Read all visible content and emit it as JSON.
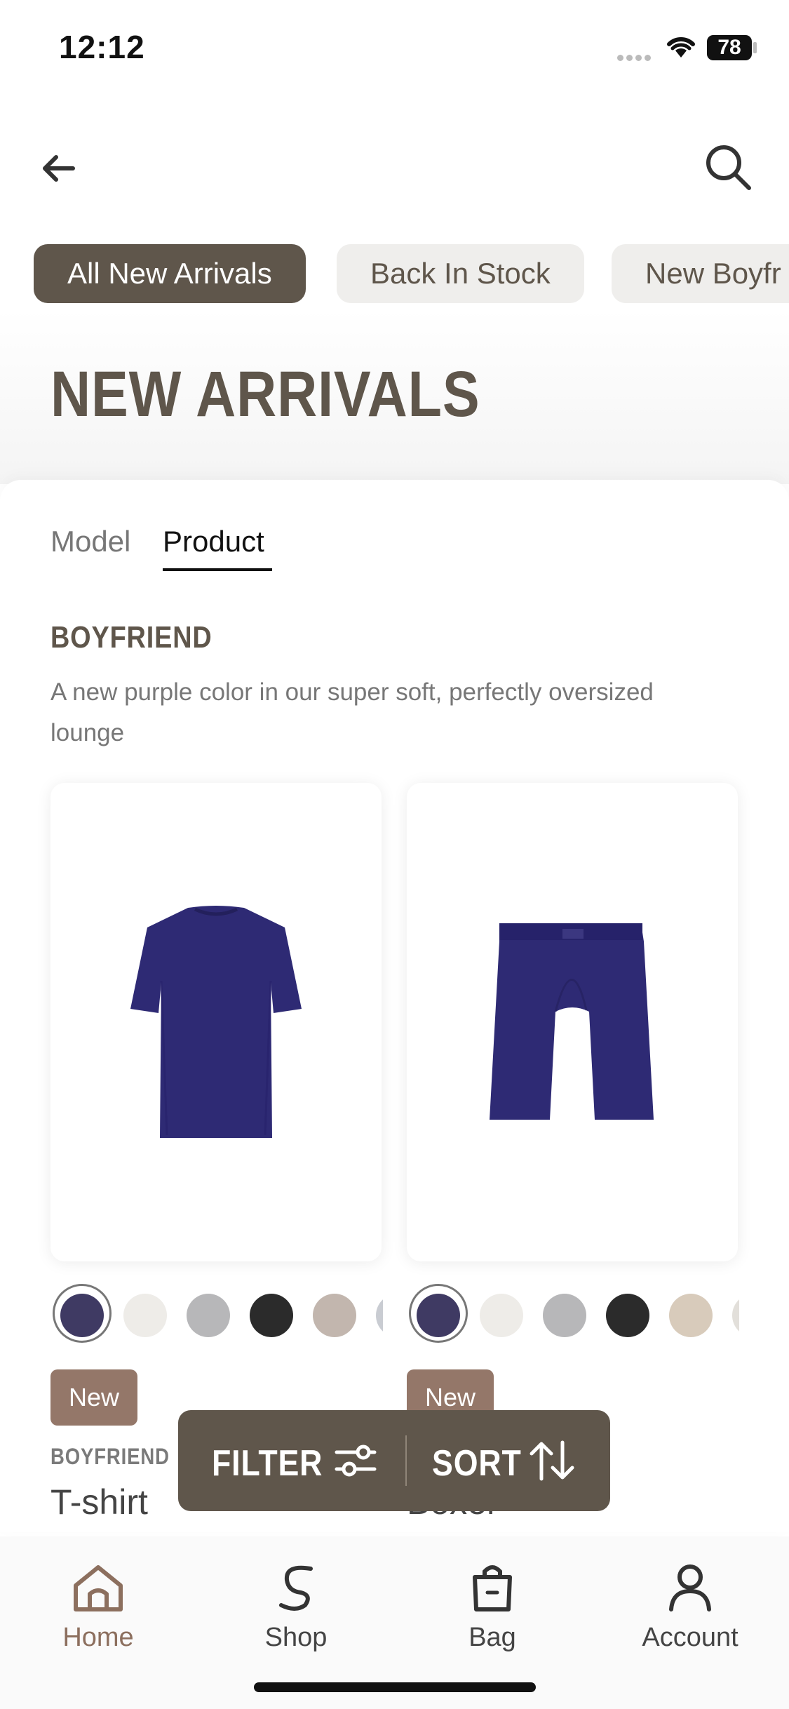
{
  "status_bar": {
    "time": "12:12",
    "battery": "78"
  },
  "chips": [
    {
      "label": "All New Arrivals"
    },
    {
      "label": "Back In Stock"
    },
    {
      "label": "New Boyfr"
    }
  ],
  "page_title": "NEW ARRIVALS",
  "view_tabs": {
    "model": "Model",
    "product": "Product",
    "selected": "Product"
  },
  "section": {
    "heading": "BOYFRIEND",
    "description": "A new purple color in our super soft, perfectly oversized lounge"
  },
  "products": [
    {
      "badge": "New",
      "brand": "BOYFRIEND",
      "name": "T-shirt",
      "image_icon": "tshirt-icon",
      "swatches": [
        "#3f3a63",
        "#eeece8",
        "#b7b7b9",
        "#2b2b2b",
        "#c2b6ae"
      ]
    },
    {
      "badge": "New",
      "brand": "",
      "name": "Boxer",
      "image_icon": "boxer-shorts-icon",
      "swatches": [
        "#3f3a63",
        "#eeece8",
        "#b7b7b9",
        "#2b2b2b",
        "#d8cbbb"
      ]
    }
  ],
  "filter_sort": {
    "filter_label": "FILTER",
    "sort_label": "SORT"
  },
  "bottom_nav": {
    "items": [
      {
        "label": "Home",
        "icon": "home-icon",
        "active": true
      },
      {
        "label": "Shop",
        "icon": "shop-s-icon",
        "active": false
      },
      {
        "label": "Bag",
        "icon": "bag-icon",
        "active": false
      },
      {
        "label": "Account",
        "icon": "account-icon",
        "active": false
      }
    ]
  },
  "colors": {
    "brand_brown": "#5f564b",
    "badge": "#947769",
    "active_nav": "#8c6f5e",
    "product_navy": "#2e2a74"
  }
}
